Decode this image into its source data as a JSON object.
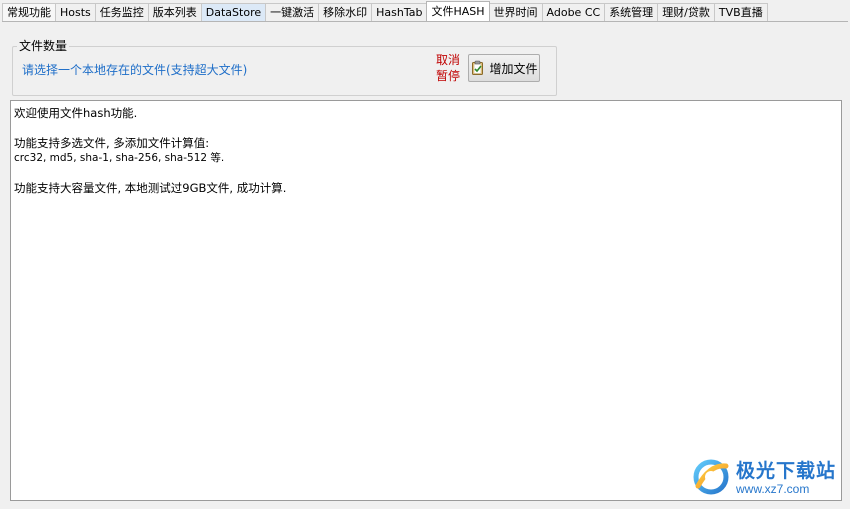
{
  "tabs": [
    {
      "label": "常规功能"
    },
    {
      "label": "Hosts"
    },
    {
      "label": "任务监控"
    },
    {
      "label": "版本列表"
    },
    {
      "label": "DataStore"
    },
    {
      "label": "一键激活"
    },
    {
      "label": "移除水印"
    },
    {
      "label": "HashTab"
    },
    {
      "label": "文件HASH"
    },
    {
      "label": "世界时间"
    },
    {
      "label": "Adobe CC"
    },
    {
      "label": "系统管理"
    },
    {
      "label": "理财/贷款"
    },
    {
      "label": "TVB直播"
    }
  ],
  "active_tab": "文件HASH",
  "file_group": {
    "title": "文件数量",
    "select_link": "请选择一个本地存在的文件(支持超大文件)",
    "cancel": "取消",
    "pause": "暂停",
    "add_button": "增加文件"
  },
  "output": {
    "lines": [
      "欢迎使用文件hash功能.",
      "",
      "功能支持多选文件, 多添加文件计算值:",
      "crc32, md5, sha-1, sha-256, sha-512 等.",
      "",
      "功能支持大容量文件, 本地测试过9GB文件, 成功计算."
    ]
  },
  "watermark": {
    "title": "极光下载站",
    "url": "www.xz7.com"
  },
  "colors": {
    "link": "#1e6ec8",
    "cancel": "#c00000",
    "active_tab": "#ffffff",
    "highlight_tab": "#dce9f7"
  }
}
